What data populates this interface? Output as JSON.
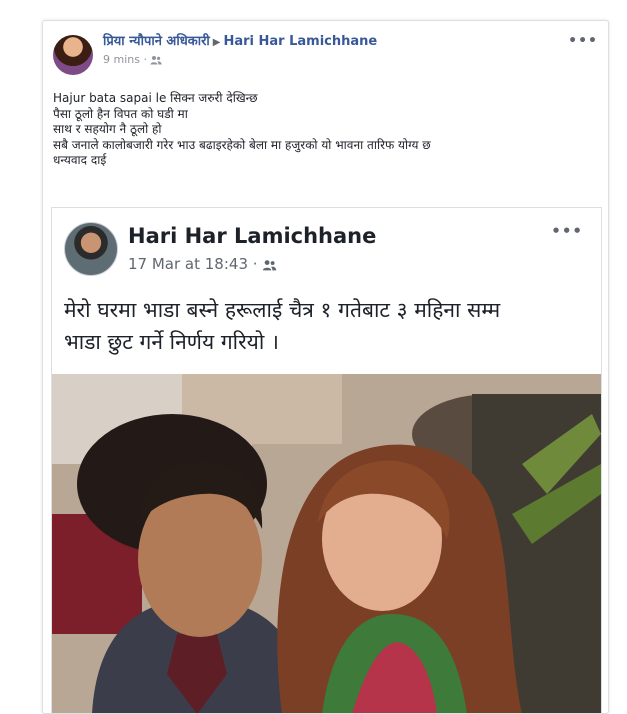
{
  "post": {
    "author": "प्रिया न्यौपाने अधिकारी",
    "arrow": "▶",
    "target": "Hari Har Lamichhane",
    "time": "9 mins ·",
    "more": "•••",
    "text_lines": [
      "Hajur bata sapai le सिक्न जरुरी देखिन्छ",
      "पैसा ठूलो हैन विपत को घडी मा",
      "साथ र सहयोग नै ठूलो हो",
      "सबै जनाले कालोबजारी गरेर भाउ बढाइरहेको बेला मा हजुरको यो भावना तारिफ योग्य छ",
      "धन्यवाद दाई"
    ]
  },
  "shared": {
    "name": "Hari Har Lamichhane",
    "time": "17 Mar at 18:43 ·",
    "more": "•••",
    "text_lines": [
      "मेरो घरमा भाडा बस्ने हरूलाई चैत्र १ गतेबाट ३ महिना सम्म",
      "भाडा छुट गर्ने निर्णय गरियो ।"
    ]
  },
  "icons": {
    "audience": "friends-audience-icon",
    "more": "more-options-icon"
  },
  "colors": {
    "link": "#385898",
    "meta": "#90949c",
    "text": "#1d2129",
    "border": "#dddfe2"
  }
}
